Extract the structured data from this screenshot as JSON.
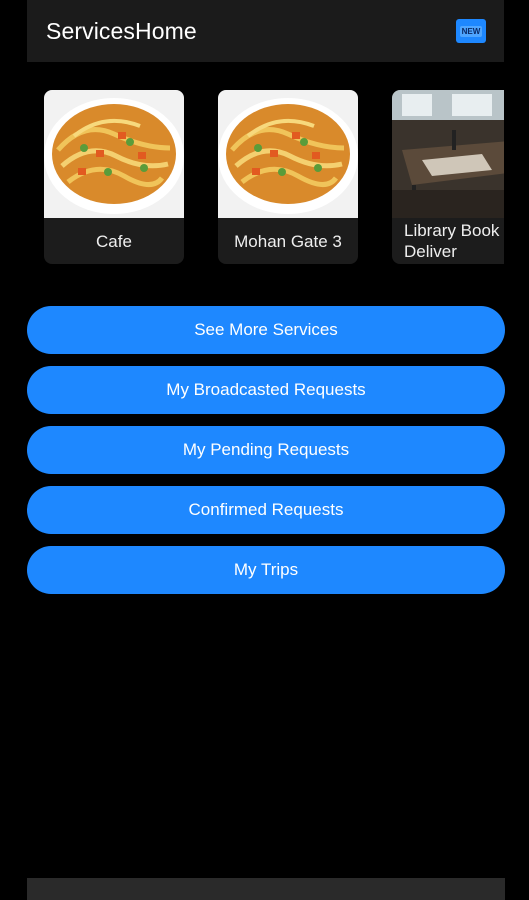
{
  "appbar": {
    "title": "ServicesHome",
    "badge": "NEW"
  },
  "services": [
    {
      "label": "Cafe",
      "image": "noodles-icon"
    },
    {
      "label": "Mohan Gate 3",
      "image": "noodles-icon"
    },
    {
      "label": "Library Book Deliver",
      "image": "library-icon"
    }
  ],
  "buttons": {
    "see_more": "See More Services",
    "broadcasted": "My Broadcasted Requests",
    "pending": "My Pending Requests",
    "confirmed": "Confirmed Requests",
    "trips": "My Trips"
  },
  "colors": {
    "accent": "#1e88ff",
    "background": "#000000",
    "appbar": "#1b1b1b"
  }
}
